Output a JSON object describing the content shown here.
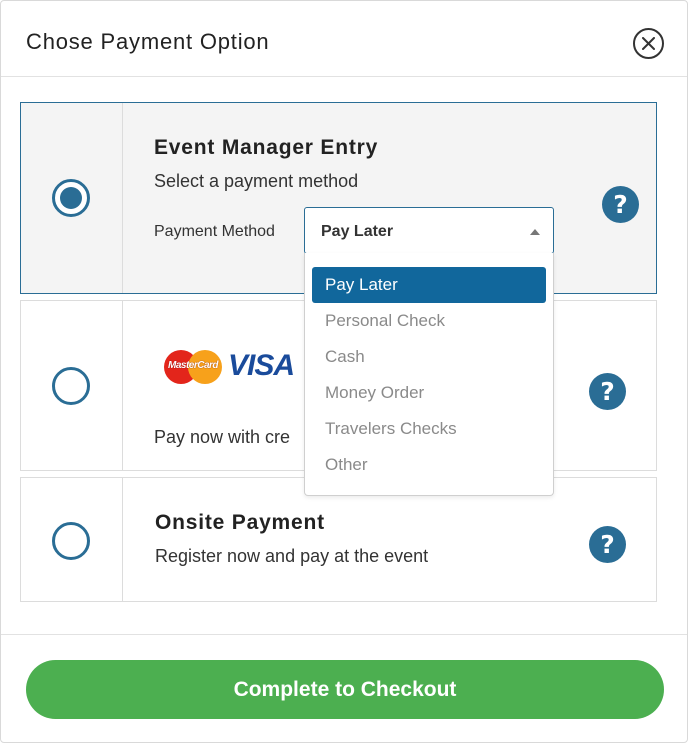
{
  "modal": {
    "title": "Chose Payment Option"
  },
  "options": {
    "event_manager": {
      "title": "Event Manager Entry",
      "subtitle": "Select a payment method",
      "payment_method_label": "Payment Method",
      "selected_value": "Pay Later",
      "selected": true
    },
    "credit_card": {
      "logo_mastercard": "MasterCard",
      "logo_visa": "VISA",
      "subtitle": "Pay now with cre",
      "selected": false
    },
    "onsite": {
      "title": "Onsite Payment",
      "subtitle": "Register now and pay at the event",
      "selected": false
    },
    "help_glyph": "?"
  },
  "dropdown": {
    "options": [
      "Pay Later",
      "Personal Check",
      "Cash",
      "Money Order",
      "Travelers Checks",
      "Other"
    ],
    "highlighted_index": 0
  },
  "footer": {
    "checkout_label": "Complete to Checkout"
  },
  "colors": {
    "accent": "#2a6d95",
    "dropdown_highlight": "#11679c",
    "checkout": "#4caf50"
  },
  "icons": {
    "close": "close-icon",
    "help": "help-icon",
    "caret": "caret-up-icon"
  }
}
